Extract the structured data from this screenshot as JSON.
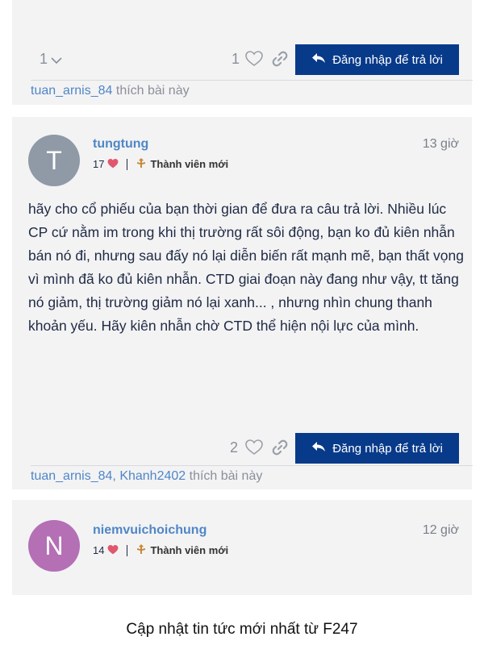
{
  "reply_button_label": "Đăng nhập để trả lời",
  "top_post": {
    "reply_count": "1",
    "like_count": "1",
    "likers": [
      {
        "name": "tuan_arnis_84"
      }
    ],
    "likes_suffix": "thích bài này"
  },
  "post": {
    "avatar_letter": "T",
    "avatar_color": "#8f9aa6",
    "username": "tungtung",
    "timestamp": "13 giờ",
    "likes_received": "17",
    "user_title": "Thành viên mới",
    "body": "hãy cho cổ phiếu của bạn thời gian để đưa ra câu trả lời. Nhiều lúc CP cứ nằm im trong khi thị trường rất sôi động, bạn ko đủ kiên nhẫn bán nó đi, nhưng sau đấy nó lại diễn biến rất mạnh mẽ, bạn thất vọng vì mình đã ko đủ kiên nhẫn. CTD giai đoạn này đang như vậy, tt tăng nó giảm, thị trường giảm nó lại xanh... , nhưng nhìn chung thanh khoản yếu. Hãy kiên nhẫn chờ CTD thể hiện nội lực của mình.",
    "like_count": "2",
    "likers": [
      {
        "name": "tuan_arnis_84"
      },
      {
        "name": "Khanh2402"
      }
    ],
    "likes_suffix": "thích bài này"
  },
  "next_post": {
    "avatar_letter": "N",
    "avatar_color": "#b56fb5",
    "username": "niemvuichoichung",
    "timestamp": "12 giờ",
    "likes_received": "14",
    "user_title": "Thành viên mới"
  },
  "footer": "Cập nhật tin tức mới nhất từ F247",
  "colors": {
    "accent_button": "#083a8a",
    "username": "#4f86c6",
    "heart": "#e0576e",
    "panel_bg": "#f3f3f4"
  }
}
